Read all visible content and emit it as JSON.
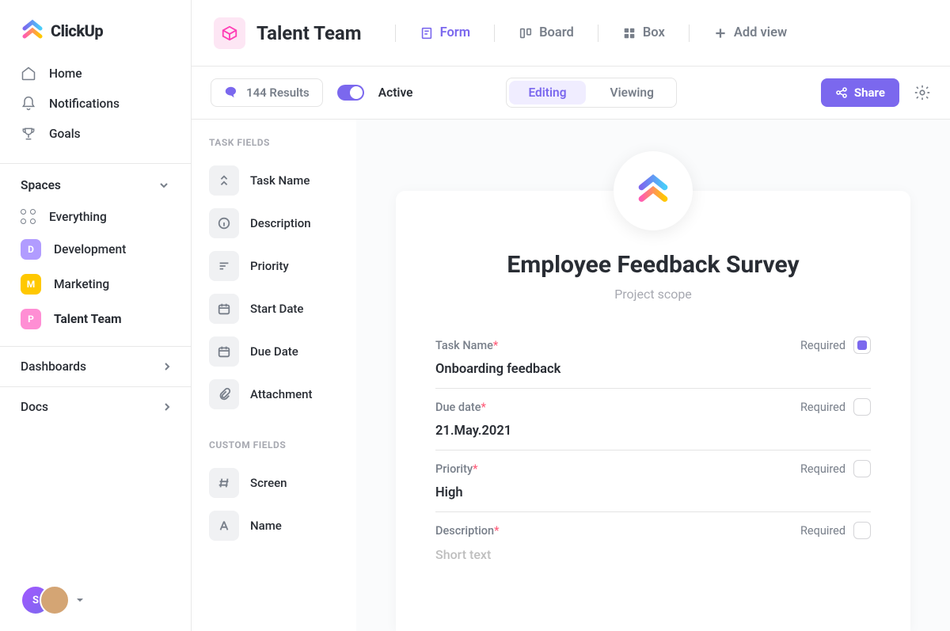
{
  "brand": "ClickUp",
  "sidebar": {
    "nav": [
      {
        "label": "Home"
      },
      {
        "label": "Notifications"
      },
      {
        "label": "Goals"
      }
    ],
    "spaces_header": "Spaces",
    "spaces": [
      {
        "label": "Everything",
        "type": "grid"
      },
      {
        "label": "Development",
        "badge": "D",
        "color": "#b19cff"
      },
      {
        "label": "Marketing",
        "badge": "M",
        "color": "#ffc800"
      },
      {
        "label": "Talent Team",
        "badge": "P",
        "color": "#ff5db2",
        "active": true
      }
    ],
    "bottom": [
      {
        "label": "Dashboards"
      },
      {
        "label": "Docs"
      }
    ],
    "avatars": [
      {
        "initial": "S",
        "color": "#a259ff"
      },
      {
        "initial": "",
        "color": "#4a4a4a"
      }
    ]
  },
  "header": {
    "page_title": "Talent Team",
    "views": [
      {
        "label": "Form",
        "active": true
      },
      {
        "label": "Board"
      },
      {
        "label": "Box"
      }
    ],
    "add_view": "Add view"
  },
  "toolbar": {
    "results": "144 Results",
    "active": "Active",
    "modes": {
      "editing": "Editing",
      "viewing": "Viewing"
    },
    "share": "Share"
  },
  "fields_panel": {
    "task_heading": "TASK FIELDS",
    "task_fields": [
      {
        "label": "Task Name",
        "icon": "double-chevron"
      },
      {
        "label": "Description",
        "icon": "info"
      },
      {
        "label": "Priority",
        "icon": "priority"
      },
      {
        "label": "Start Date",
        "icon": "calendar"
      },
      {
        "label": "Due Date",
        "icon": "calendar"
      },
      {
        "label": "Attachment",
        "icon": "paperclip"
      }
    ],
    "custom_heading": "CUSTOM FIELDS",
    "custom_fields": [
      {
        "label": "Screen",
        "icon": "hash"
      },
      {
        "label": "Name",
        "icon": "text"
      }
    ]
  },
  "form": {
    "title": "Employee Feedback Survey",
    "subtitle": "Project scope",
    "required_label": "Required",
    "fields": [
      {
        "label": "Task Name",
        "value": "Onboarding feedback",
        "required": true,
        "checked": true
      },
      {
        "label": "Due date",
        "value": "21.May.2021",
        "required": true,
        "checked": false
      },
      {
        "label": "Priority",
        "value": "High",
        "required": true,
        "checked": false
      },
      {
        "label": "Description",
        "value": "Short text",
        "required": true,
        "checked": false,
        "placeholder": true
      }
    ]
  }
}
